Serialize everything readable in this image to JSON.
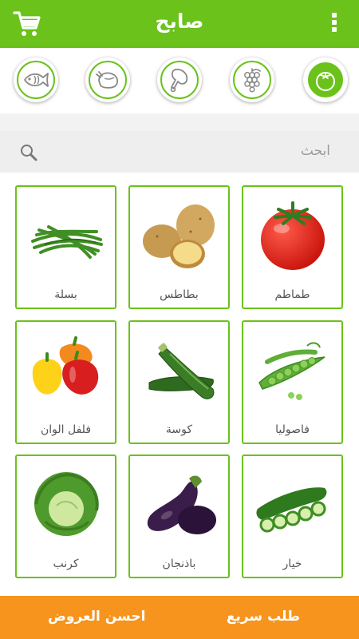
{
  "header": {
    "title": "صابح",
    "cart_icon": "cart-icon",
    "menu_icon": "kebab-menu-icon"
  },
  "categories": [
    {
      "icon": "fish-icon",
      "active": false
    },
    {
      "icon": "chicken-icon",
      "active": false
    },
    {
      "icon": "meat-icon",
      "active": false
    },
    {
      "icon": "grapes-icon",
      "active": false
    },
    {
      "icon": "tomato-icon",
      "active": true
    }
  ],
  "search": {
    "placeholder": "ابحث",
    "icon": "search-icon"
  },
  "products": [
    {
      "label": "طماطم",
      "icon": "tomato-image"
    },
    {
      "label": "بطاطس",
      "icon": "potato-image"
    },
    {
      "label": "بسلة",
      "icon": "green-beans-image"
    },
    {
      "label": "فاصوليا",
      "icon": "peas-image"
    },
    {
      "label": "كوسة",
      "icon": "zucchini-image"
    },
    {
      "label": "فلفل الوان",
      "icon": "bell-peppers-image"
    },
    {
      "label": "خيار",
      "icon": "cucumber-image"
    },
    {
      "label": "باذنجان",
      "icon": "eggplant-image"
    },
    {
      "label": "كرنب",
      "icon": "cabbage-image"
    }
  ],
  "footer": {
    "quick_order": "طلب سريع",
    "best_offers": "احسن العروض"
  },
  "colors": {
    "primary": "#6ac21b",
    "accent": "#f7941d"
  }
}
